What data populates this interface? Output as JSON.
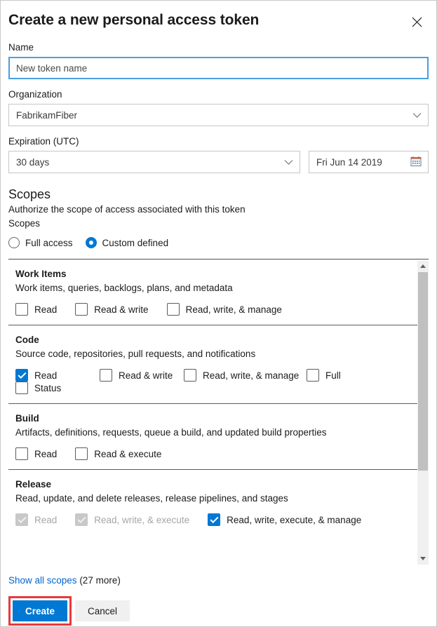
{
  "dialog": {
    "title": "Create a new personal access token",
    "close_icon": "close-icon"
  },
  "form": {
    "name_label": "Name",
    "name_placeholder": "New token name",
    "name_value": "",
    "organization_label": "Organization",
    "organization_value": "FabrikamFiber",
    "expiration_label": "Expiration (UTC)",
    "expiration_value": "30 days",
    "expiration_date": "Fri Jun 14 2019",
    "calendar_icon": "calendar-icon",
    "chevron_icon": "chevron-down-icon"
  },
  "scopes": {
    "heading": "Scopes",
    "description": "Authorize the scope of access associated with this token",
    "radio_group_label": "Scopes",
    "options": [
      {
        "label": "Full access",
        "selected": false
      },
      {
        "label": "Custom defined",
        "selected": true
      }
    ],
    "groups": [
      {
        "name": "Work Items",
        "description": "Work items, queries, backlogs, plans, and metadata",
        "checkboxes": [
          {
            "label": "Read",
            "checked": false,
            "disabled": false
          },
          {
            "label": "Read & write",
            "checked": false,
            "disabled": false
          },
          {
            "label": "Read, write, & manage",
            "checked": false,
            "disabled": false
          }
        ]
      },
      {
        "name": "Code",
        "description": "Source code, repositories, pull requests, and notifications",
        "checkboxes": [
          {
            "label": "Read",
            "checked": true,
            "disabled": false
          },
          {
            "label": "Read & write",
            "checked": false,
            "disabled": false
          },
          {
            "label": "Read, write, & manage",
            "checked": false,
            "disabled": false
          },
          {
            "label": "Full",
            "checked": false,
            "disabled": false
          },
          {
            "label": "Status",
            "checked": false,
            "disabled": false
          }
        ]
      },
      {
        "name": "Build",
        "description": "Artifacts, definitions, requests, queue a build, and updated build properties",
        "checkboxes": [
          {
            "label": "Read",
            "checked": false,
            "disabled": false
          },
          {
            "label": "Read & execute",
            "checked": false,
            "disabled": false
          }
        ]
      },
      {
        "name": "Release",
        "description": "Read, update, and delete releases, release pipelines, and stages",
        "checkboxes": [
          {
            "label": "Read",
            "checked": true,
            "disabled": true
          },
          {
            "label": "Read, write, & execute",
            "checked": true,
            "disabled": true
          },
          {
            "label": "Read, write, execute, & manage",
            "checked": true,
            "disabled": false
          }
        ]
      }
    ],
    "show_all_link": "Show all scopes",
    "show_all_count": " (27 more)"
  },
  "footer": {
    "create_label": "Create",
    "cancel_label": "Cancel"
  },
  "colors": {
    "accent": "#0078d4",
    "link": "#0066cc",
    "highlight": "#e8393c",
    "focus_border": "#4a9fe0"
  }
}
